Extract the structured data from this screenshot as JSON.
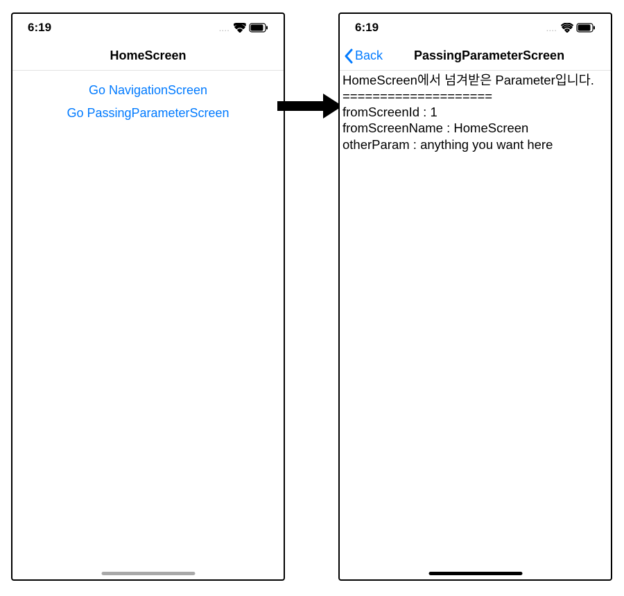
{
  "status": {
    "time": "6:19",
    "signal_dots": "...."
  },
  "colors": {
    "link": "#007aff"
  },
  "left_screen": {
    "nav_title": "HomeScreen",
    "links": [
      {
        "label": "Go NavigationScreen"
      },
      {
        "label": "Go PassingParameterScreen"
      }
    ]
  },
  "right_screen": {
    "back_label": "Back",
    "nav_title": "PassingParameterScreen",
    "body_lines": [
      "HomeScreen에서 넘겨받은 Parameter입니다.",
      "====================",
      "fromScreenId : 1",
      "fromScreenName : HomeScreen",
      "otherParam : anything you want here"
    ]
  }
}
